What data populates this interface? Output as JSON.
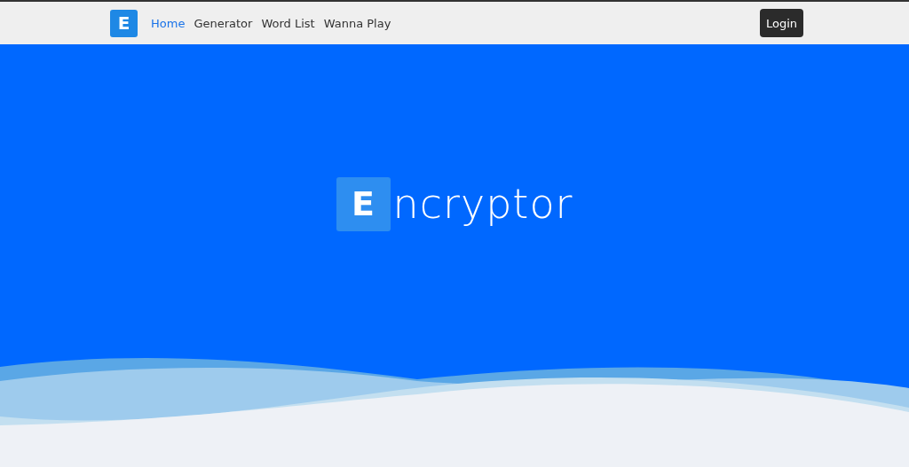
{
  "navbar": {
    "logo": "E",
    "links": [
      {
        "label": "Home",
        "selected": true
      },
      {
        "label": "Generator",
        "selected": false
      },
      {
        "label": "Word List",
        "selected": false
      },
      {
        "label": "Wanna Play",
        "selected": false
      }
    ],
    "login_button": "Login"
  },
  "hero": {
    "logo_letter": "E",
    "title_rest": "ncryptor"
  }
}
